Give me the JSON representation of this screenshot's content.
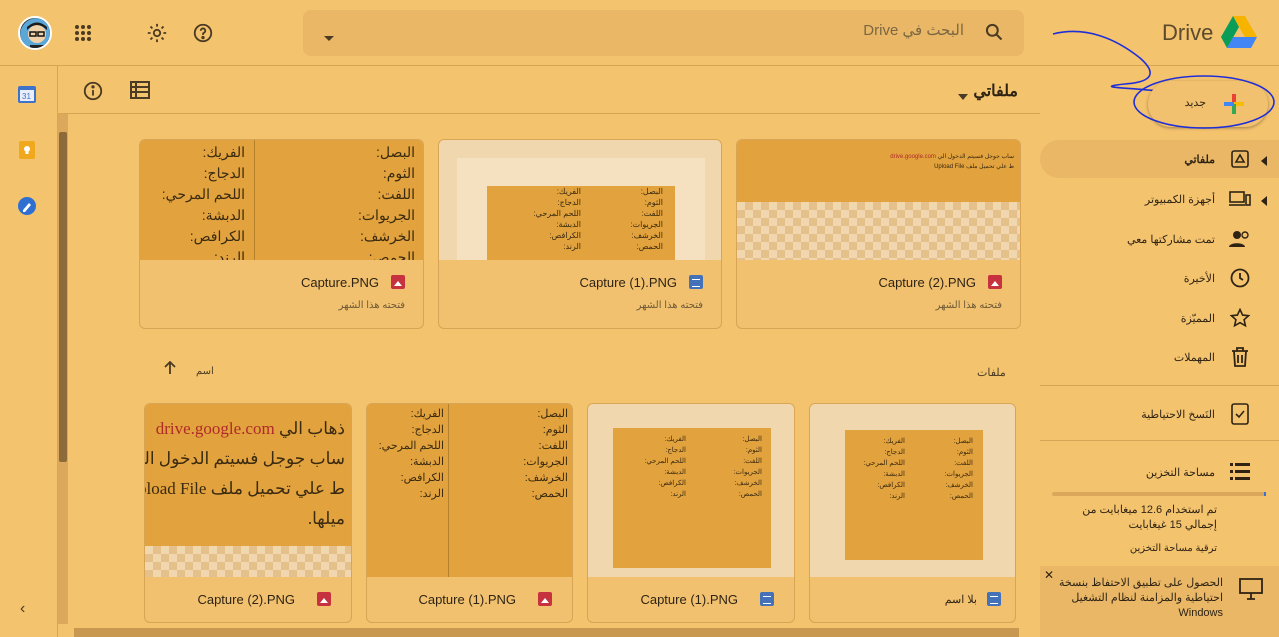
{
  "header": {
    "app_name": "Drive",
    "search_placeholder": "البحث في Drive"
  },
  "toolbar": {
    "title": "ملفاتي"
  },
  "sidebar": {
    "new_label": "جديد",
    "items": [
      {
        "label": "ملفاتي",
        "icon": "drive-icon",
        "active": true
      },
      {
        "label": "أجهزة الكمبيوتر",
        "icon": "computer-icon"
      },
      {
        "label": "تمت مشاركتها معي",
        "icon": "people-icon"
      },
      {
        "label": "الأخيرة",
        "icon": "clock-icon"
      },
      {
        "label": "المميّزة",
        "icon": "star-icon"
      },
      {
        "label": "المهملات",
        "icon": "trash-icon"
      },
      {
        "label": "النَسخ الاحتياطية",
        "icon": "backup-icon"
      },
      {
        "label": "مساحة التخزين",
        "icon": "storage-icon"
      }
    ],
    "storage_text": "تم استخدام 12.6 ميغابايت من إجمالي 15 غيغابايت",
    "storage_used_fraction": 0.0008,
    "upgrade_label": "ترقية مساحة التخزين",
    "backup_text": "الحصول على تطبيق الاحتفاظ بنسخة احتياطية والمزامنة لنظام التشغيل Windows"
  },
  "quick_access": [
    {
      "name": "Capture (2).PNG",
      "sub": "فتحته هذا الشهر",
      "type": "image"
    },
    {
      "name": "Capture (1).PNG",
      "sub": "فتحته هذا الشهر",
      "type": "doc"
    },
    {
      "name": "Capture.PNG",
      "sub": "فتحته هذا الشهر",
      "type": "image"
    }
  ],
  "labels": {
    "files": "ملفات",
    "name": "اسم"
  },
  "files": [
    {
      "name": "بلا اسم",
      "type": "doc"
    },
    {
      "name": "Capture (1).PNG",
      "type": "doc"
    },
    {
      "name": "Capture (1).PNG",
      "type": "image"
    },
    {
      "name": "Capture (2).PNG",
      "type": "image"
    }
  ],
  "thumb_text": {
    "left_col": "البصل:\nالثوم:\nاللفت:\nالجريوات:\nالخرشف:\nالحمص:",
    "right_col": "الفريك:\nالدجاج:\nاللحم المرحي:\nالدبشة:\nالكرافص:\nالرند:",
    "url_snippet": "drive.google.com",
    "line1": "ذهاب الي",
    "line2": "ساب جوجل فسيتم الدخول الي",
    "line3": "ط علي تحميل ملف Upload File",
    "line4": "ميلها."
  }
}
